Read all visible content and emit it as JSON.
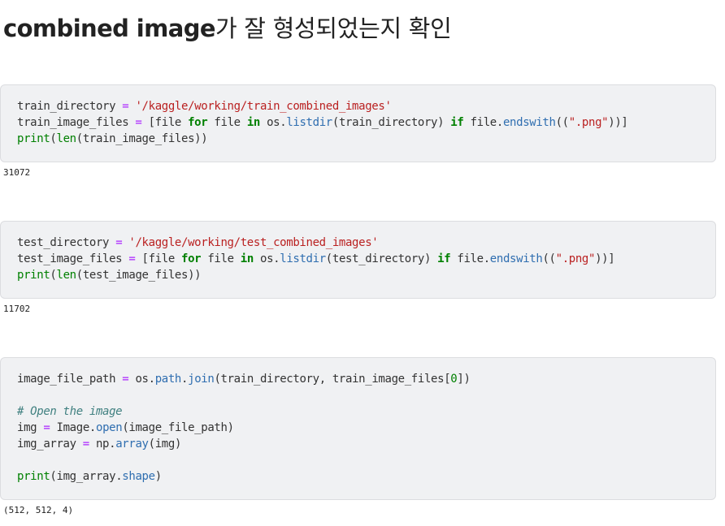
{
  "heading": {
    "latin": "combined image",
    "korean": "가 잘 형성되었는지 확인"
  },
  "cells": [
    {
      "lines": [
        {
          "t1": "train_directory ",
          "op1": "=",
          "s1": " ",
          "str1": "'/kaggle/working/train_combined_images'"
        },
        {
          "t1": "train_image_files ",
          "op1": "=",
          "s1": " [file ",
          "kw1": "for",
          "s2": " file ",
          "kw2": "in",
          "s3": " os.",
          "a1": "listdir",
          "s4": "(train_directory) ",
          "kw3": "if",
          "s5": " file.",
          "a2": "endswith",
          "s6": "((",
          "str1": "\".png\"",
          "s7": "))]"
        },
        {
          "bi1": "print",
          "s1": "(",
          "bi2": "len",
          "s2": "(train_image_files))"
        }
      ],
      "output": "31072"
    },
    {
      "lines": [
        {
          "t1": "test_directory ",
          "op1": "=",
          "s1": " ",
          "str1": "'/kaggle/working/test_combined_images'"
        },
        {
          "t1": "test_image_files ",
          "op1": "=",
          "s1": " [file ",
          "kw1": "for",
          "s2": " file ",
          "kw2": "in",
          "s3": " os.",
          "a1": "listdir",
          "s4": "(test_directory) ",
          "kw3": "if",
          "s5": " file.",
          "a2": "endswith",
          "s6": "((",
          "str1": "\".png\"",
          "s7": "))]"
        },
        {
          "bi1": "print",
          "s1": "(",
          "bi2": "len",
          "s2": "(test_image_files))"
        }
      ],
      "output": "11702"
    },
    {
      "lines": [
        {
          "t1": "image_file_path ",
          "op1": "=",
          "s1": " os.",
          "a1": "path",
          "s2": ".",
          "a2": "join",
          "s3": "(train_directory, train_image_files[",
          "n1": "0",
          "s4": "])"
        },
        {
          "cm1": "# Open the image"
        },
        {
          "t1": "img ",
          "op1": "=",
          "s1": " Image.",
          "a1": "open",
          "s2": "(image_file_path)"
        },
        {
          "t1": "img_array ",
          "op1": "=",
          "s1": " np.",
          "a1": "array",
          "s2": "(img)"
        },
        {
          "bi1": "print",
          "s1": "(img_array.",
          "a1": "shape",
          "s2": ")"
        }
      ],
      "output": "(512, 512, 4)"
    }
  ]
}
